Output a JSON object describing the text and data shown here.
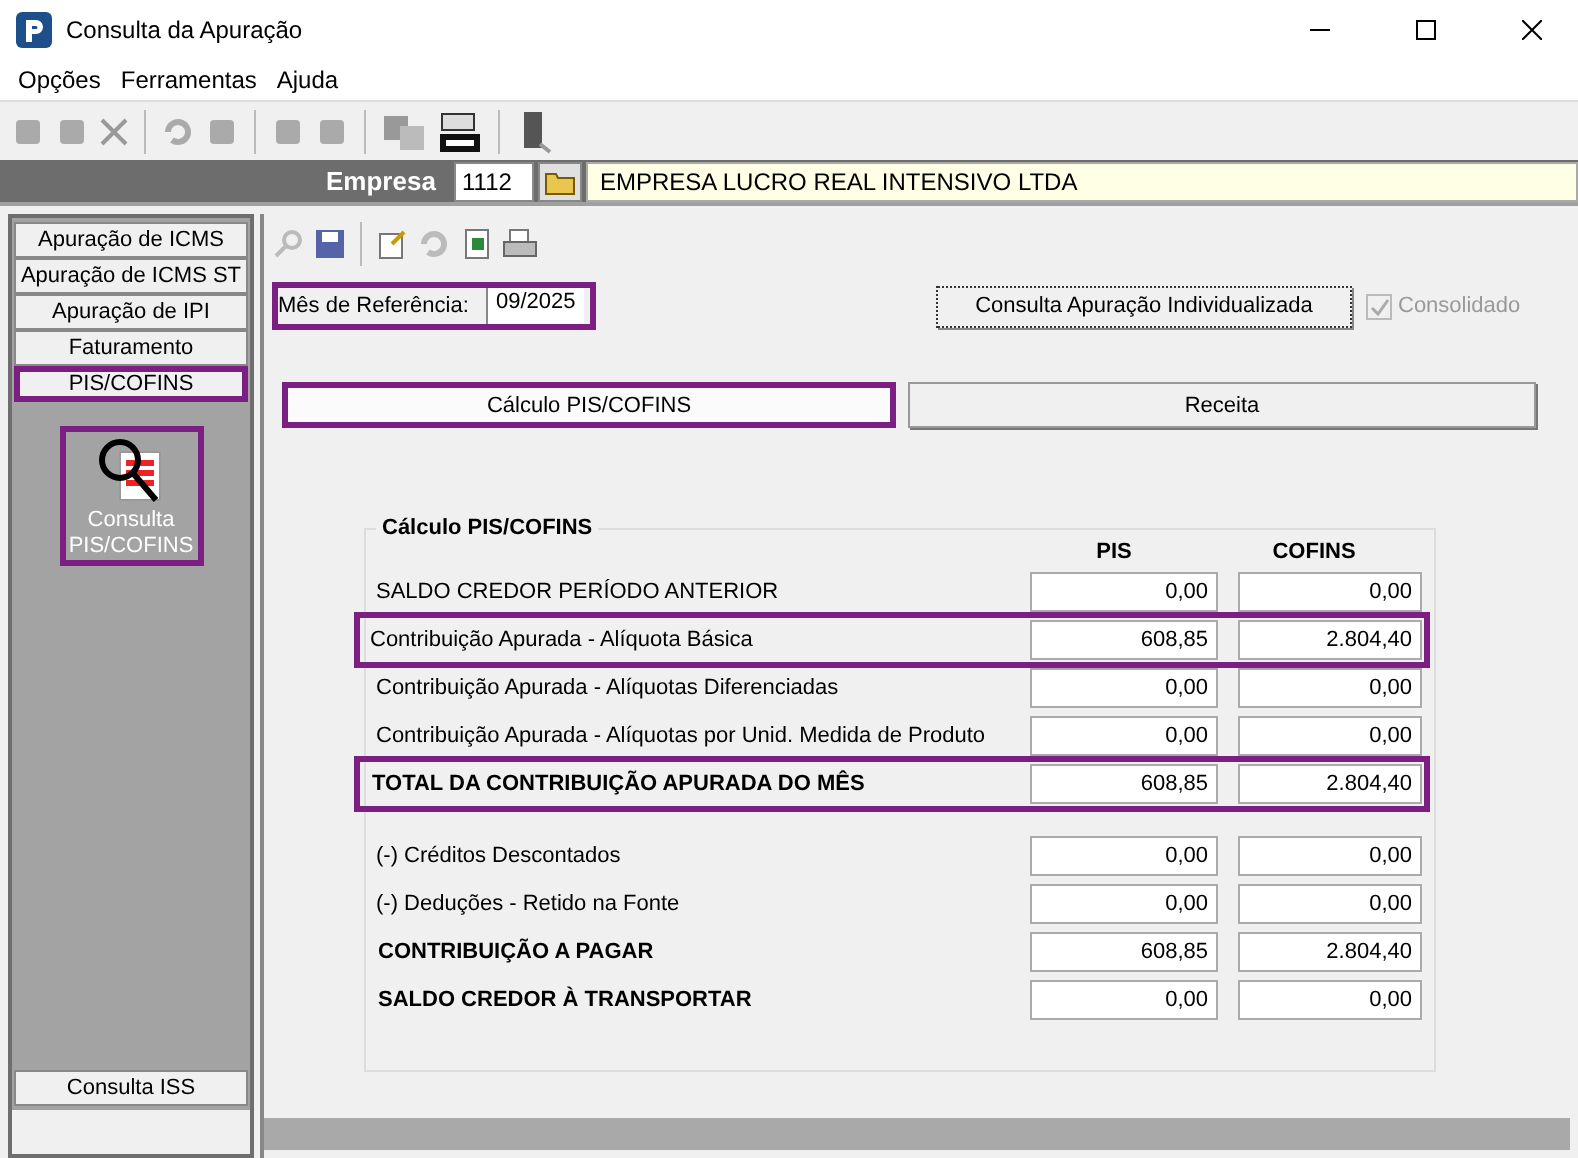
{
  "window": {
    "title": "Consulta da Apuração"
  },
  "menu": [
    "Opções",
    "Ferramentas",
    "Ajuda"
  ],
  "company": {
    "label": "Empresa",
    "code": "1112",
    "name": "EMPRESA LUCRO REAL INTENSIVO LTDA"
  },
  "sidebar": {
    "items": [
      {
        "label": "Apuração de ICMS",
        "highlighted": false
      },
      {
        "label": "Apuração de ICMS ST",
        "highlighted": false
      },
      {
        "label": "Apuração de IPI",
        "highlighted": false
      },
      {
        "label": "Faturamento",
        "highlighted": false
      },
      {
        "label": "PIS/COFINS",
        "highlighted": true
      }
    ],
    "tile": {
      "label": "Consulta PIS/COFINS",
      "highlighted": true
    },
    "bottom_item": {
      "label": "Consulta ISS"
    }
  },
  "reference": {
    "label": "Mês de Referência:",
    "value": "09/2025",
    "highlighted": true
  },
  "individual_button": "Consulta Apuração Individualizada",
  "consolidated": {
    "label": "Consolidado",
    "checked": true,
    "disabled": true
  },
  "tabs": [
    {
      "label": "Cálculo PIS/COFINS",
      "selected": true,
      "highlighted": true
    },
    {
      "label": "Receita",
      "selected": false,
      "highlighted": false
    }
  ],
  "group": {
    "title": "Cálculo PIS/COFINS",
    "columns": [
      "PIS",
      "COFINS"
    ],
    "blocks": [
      [
        {
          "label": "SALDO CREDOR PERÍODO ANTERIOR",
          "bold": false,
          "highlighted": false,
          "pis": "0,00",
          "cofins": "0,00"
        },
        {
          "label": "Contribuição Apurada - Alíquota Básica",
          "bold": false,
          "highlighted": true,
          "pis": "608,85",
          "cofins": "2.804,40"
        },
        {
          "label": "Contribuição Apurada - Alíquotas Diferenciadas",
          "bold": false,
          "highlighted": false,
          "pis": "0,00",
          "cofins": "0,00"
        },
        {
          "label": "Contribuição Apurada - Alíquotas por Unid. Medida de Produto",
          "bold": false,
          "highlighted": false,
          "pis": "0,00",
          "cofins": "0,00"
        },
        {
          "label": "TOTAL DA CONTRIBUIÇÃO APURADA DO MÊS",
          "bold": true,
          "highlighted": true,
          "pis": "608,85",
          "cofins": "2.804,40"
        }
      ],
      [
        {
          "label": "(-) Créditos Descontados",
          "bold": false,
          "highlighted": false,
          "pis": "0,00",
          "cofins": "0,00"
        },
        {
          "label": "(-) Deduções - Retido na Fonte",
          "bold": false,
          "highlighted": false,
          "pis": "0,00",
          "cofins": "0,00"
        },
        {
          "label": "CONTRIBUIÇÃO A PAGAR",
          "bold": true,
          "highlighted": false,
          "pis": "608,85",
          "cofins": "2.804,40"
        },
        {
          "label": "SALDO CREDOR À TRANSPORTAR",
          "bold": true,
          "highlighted": false,
          "pis": "0,00",
          "cofins": "0,00"
        }
      ]
    ]
  }
}
